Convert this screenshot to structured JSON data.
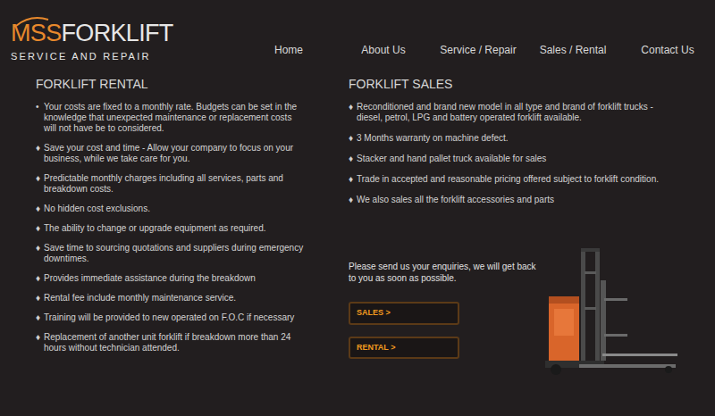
{
  "logo": {
    "brand_accent": "MSS",
    "brand": "FORKLIFT",
    "tagline": "SERVICE AND REPAIR"
  },
  "nav": [
    {
      "label": "Home"
    },
    {
      "label": "About Us"
    },
    {
      "label": "Service / Repair"
    },
    {
      "label": "Sales / Rental"
    },
    {
      "label": "Contact Us"
    }
  ],
  "rental": {
    "title": "FORKLIFT RENTAL",
    "items": [
      {
        "bullet": "•",
        "text": "Your costs are fixed to a monthly rate. Budgets can be set in the knowledge that unexpected maintenance or replacement costs will not have be to considered."
      },
      {
        "bullet": "♦",
        "text": "Save your cost and time - Allow your company to focus on your business, while we take care for you."
      },
      {
        "bullet": "♦",
        "text": "Predictable monthly charges including all services, parts and breakdown costs."
      },
      {
        "bullet": "♦",
        "text": "No hidden cost exclusions."
      },
      {
        "bullet": "♦",
        "text": "The ability to change or upgrade equipment as required."
      },
      {
        "bullet": "♦",
        "text": "Save time to sourcing quotations and suppliers during emergency downtimes."
      },
      {
        "bullet": "♦",
        "text": "Provides immediate assistance during the breakdown"
      },
      {
        "bullet": "♦",
        "text": "Rental fee include monthly maintenance service."
      },
      {
        "bullet": "♦",
        "text": "Training will be provided to new operated on F.O.C if necessary"
      },
      {
        "bullet": "♦",
        "text": "Replacement of another unit forklift if breakdown more than 24 hours without technician attended."
      }
    ]
  },
  "sales": {
    "title": "FORKLIFT SALES",
    "items": [
      {
        "bullet": "♦",
        "text": "Reconditioned and brand new model in all type and brand of forklift trucks - diesel, petrol, LPG and battery operated forklift available."
      },
      {
        "bullet": "♦",
        "text": "3 Months warranty on machine defect."
      },
      {
        "bullet": "♦",
        "text": "Stacker and hand pallet truck available for sales"
      },
      {
        "bullet": "♦",
        "text": "Trade in accepted and reasonable pricing offered subject to forklift condition."
      },
      {
        "bullet": "♦",
        "text": "We also sales all the forklift accessories and parts"
      }
    ]
  },
  "enquiry": {
    "text": "Please send us your enquiries, we will get back to you as soon as possible.",
    "buttons": [
      {
        "label": "SALES >"
      },
      {
        "label": "RENTAL >"
      }
    ]
  }
}
